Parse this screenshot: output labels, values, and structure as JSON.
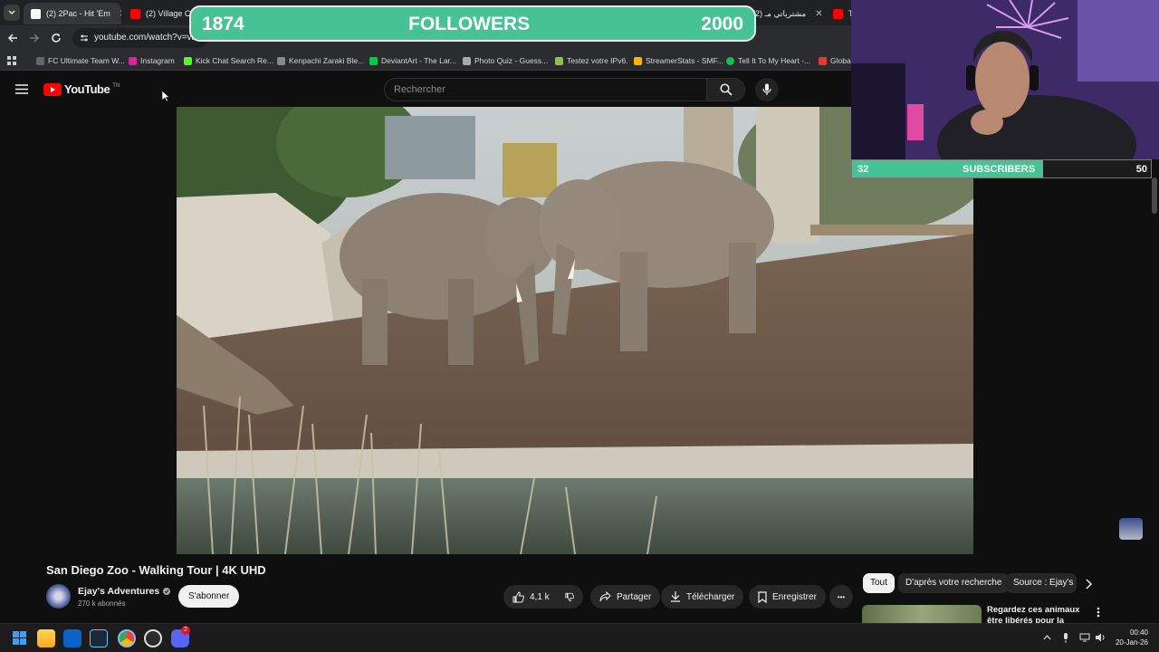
{
  "browser": {
    "tabs": [
      {
        "label": "(2) 2Pac - Hit 'Em",
        "close": "✕"
      },
      {
        "label": "(2) Village Cool",
        "close": ""
      },
      {
        "label": "مشترياتي مـ (2)",
        "close": "✕"
      },
      {
        "label": "TI",
        "close": ""
      }
    ],
    "url": "youtube.com/watch?v=vb0",
    "bookmarks": [
      "FC Ultimate Team W...",
      "Instagram",
      "Kick Chat Search Re...",
      "Kenpachi Zaraki Ble...",
      "DeviantArt - The Lar...",
      "Photo Quiz - Guess...",
      "Testez votre IPv6.",
      "StreamerStats - SMF...",
      "Tell It To My Heart -...",
      "Globa"
    ]
  },
  "youtube": {
    "logo_text": "YouTube",
    "logo_region": "TN",
    "search_placeholder": "Rechercher"
  },
  "overlay": {
    "followers": {
      "current": "1874",
      "label": "FOLLOWERS",
      "goal": "2000",
      "progress": 0.937
    },
    "subscribers": {
      "current": "32",
      "label": "SUBSCRIBERS",
      "goal": "50",
      "progress": 0.64
    }
  },
  "video": {
    "title": "San Diego Zoo - Walking Tour | 4K UHD",
    "channel": "Ejay's Adventures",
    "subscribers": "270 k abonnés",
    "subscribe_label": "S'abonner",
    "likes": "4,1 k",
    "share_label": "Partager",
    "download_label": "Télécharger",
    "save_label": "Enregistrer",
    "more_label": "•••"
  },
  "sidebar": {
    "chips": [
      "Tout",
      "D'après votre recherche",
      "Source : Ejay's"
    ],
    "recommendation": {
      "title_line1": "Regardez ces animaux",
      "title_line2": "être libérés pour la"
    }
  },
  "taskbar": {
    "time": "00:40",
    "date": "20-Jan-26",
    "badge": "2"
  },
  "colors": {
    "accent_green": "#46c295",
    "youtube_red": "#ff0000",
    "stream_purple": "#3d2a66"
  }
}
